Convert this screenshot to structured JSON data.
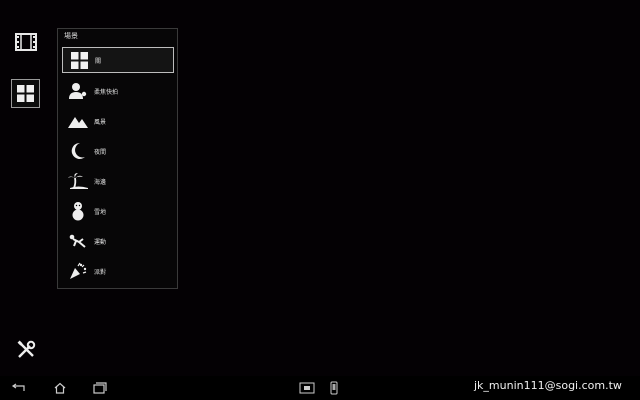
{
  "left_rail": {
    "film_icon": "film-icon",
    "scene_icon": "grid-icon",
    "tools_icon": "tools-icon"
  },
  "scene_panel": {
    "title": "場景",
    "items": [
      {
        "label": "關",
        "icon": "grid-icon",
        "selected": true
      },
      {
        "label": "柔焦快拍",
        "icon": "portrait-icon",
        "selected": false
      },
      {
        "label": "風景",
        "icon": "mountain-icon",
        "selected": false
      },
      {
        "label": "夜間",
        "icon": "moon-icon",
        "selected": false
      },
      {
        "label": "海邊",
        "icon": "beach-icon",
        "selected": false
      },
      {
        "label": "雪地",
        "icon": "snowman-icon",
        "selected": false
      },
      {
        "label": "運動",
        "icon": "sports-icon",
        "selected": false
      },
      {
        "label": "派對",
        "icon": "party-icon",
        "selected": false
      }
    ]
  },
  "navbar": {
    "buttons": [
      "back-icon",
      "home-icon",
      "recent-apps-icon",
      "camera-mode-icon",
      "phone-icon"
    ]
  },
  "watermark": "jk_munin111@sogi.com.tw"
}
